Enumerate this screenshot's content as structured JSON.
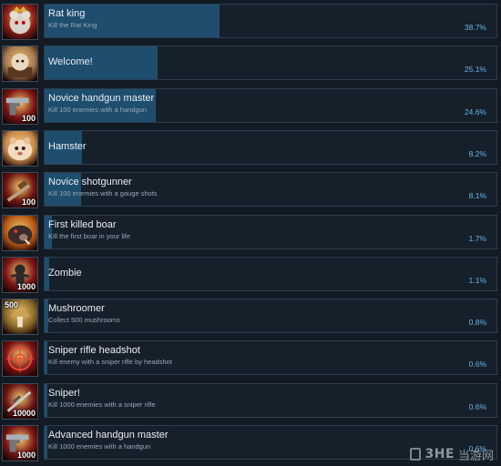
{
  "achievements": [
    {
      "name": "Rat king",
      "description": "Kill the Rat King",
      "percent": "38.7%",
      "progress": 38.7,
      "icon": "rat-king-icon",
      "icon_color": "#8a1f16",
      "badge": ""
    },
    {
      "name": "Welcome!",
      "description": "",
      "percent": "25.1%",
      "progress": 25.1,
      "icon": "welcome-icon",
      "icon_color": "#a77a4f",
      "badge": ""
    },
    {
      "name": "Novice handgun master",
      "description": "Kill 100 enemies with a handgun",
      "percent": "24.6%",
      "progress": 24.6,
      "icon": "handgun-icon",
      "icon_color": "#7a1414",
      "badge": "100"
    },
    {
      "name": "Hamster",
      "description": "",
      "percent": "8.2%",
      "progress": 8.2,
      "icon": "hamster-icon",
      "icon_color": "#c98a4e",
      "badge": ""
    },
    {
      "name": "Novice shotgunner",
      "description": "Kill 100 enemies with a gauge shots",
      "percent": "8.1%",
      "progress": 8.1,
      "icon": "shotgun-icon",
      "icon_color": "#6e1410",
      "badge": "100"
    },
    {
      "name": "First killed boar",
      "description": "Kill the first boar in your life",
      "percent": "1.7%",
      "progress": 1.7,
      "icon": "boar-icon",
      "icon_color": "#b85a17",
      "badge": ""
    },
    {
      "name": "Zombie",
      "description": "",
      "percent": "1.1%",
      "progress": 1.1,
      "icon": "zombie-icon",
      "icon_color": "#7e1515",
      "badge": "1000"
    },
    {
      "name": "Mushroomer",
      "description": "Collect 500 mushrooms",
      "percent": "0.8%",
      "progress": 0.8,
      "icon": "mushroom-icon",
      "icon_color": "#8a6a2a",
      "badge": "500"
    },
    {
      "name": "Sniper rifle headshot",
      "description": "Kill enemy with a sniper rifle by headshot",
      "percent": "0.6%",
      "progress": 0.6,
      "icon": "sniper-scope-icon",
      "icon_color": "#7a1212",
      "badge": ""
    },
    {
      "name": "Sniper!",
      "description": "Kill 1000 enemies with a sniper rifle",
      "percent": "0.6%",
      "progress": 0.6,
      "icon": "sniper-rifle-icon",
      "icon_color": "#6a1212",
      "badge": "10000"
    },
    {
      "name": "Advanced handgun master",
      "description": "Kill 1000 enemies with a handgun",
      "percent": "0.6%",
      "progress": 0.6,
      "icon": "handgun-icon",
      "icon_color": "#7a1414",
      "badge": "1000"
    }
  ],
  "watermark": {
    "text": "3HE",
    "cn": "当游网"
  },
  "colors": {
    "background": "#121a23",
    "panel": "#16202b",
    "fill": "#1f4d6e",
    "percent": "#69b1e6"
  }
}
